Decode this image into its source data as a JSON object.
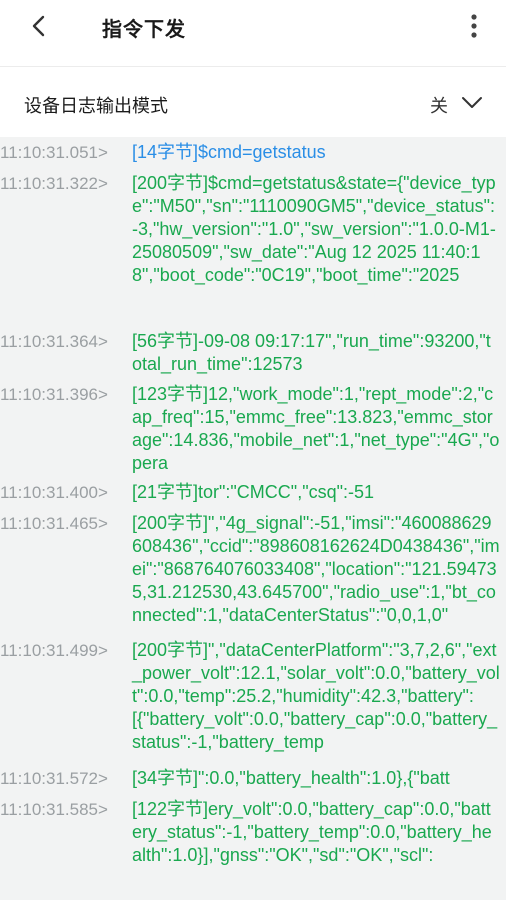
{
  "header": {
    "title": "指令下发",
    "back_icon": "chevron-left-icon",
    "more_icon": "more-vertical-icon"
  },
  "setting": {
    "label": "设备日志输出模式",
    "value": "关",
    "icon": "chevron-down-icon"
  },
  "log": {
    "colors": {
      "timestamp": "#9a9fa2",
      "sent": "#2a8ee6",
      "received": "#19a84f"
    },
    "entries": [
      {
        "time": "11:10:31.051>",
        "text": "[14字节]$cmd=getstatus",
        "kind": "sent"
      },
      {
        "time": "11:10:31.322>",
        "text": "[200字节]$cmd=getstatus&state={\"device_type\":\"M50\",\"sn\":\"1110090GM5\",\"device_status\":-3,\"hw_version\":\"1.0\",\"sw_version\":\"1.0.0-M1-25080509\",\"sw_date\":\"Aug 12 2025 11:40:18\",\"boot_code\":\"0C19\",\"boot_time\":\"2025",
        "kind": "received"
      },
      {
        "time": "11:10:31.364>",
        "text": "[56字节]-09-08 09:17:17\",\"run_time\":93200,\"total_run_time\":12573",
        "kind": "received"
      },
      {
        "time": "11:10:31.396>",
        "text": "[123字节]12,\"work_mode\":1,\"rept_mode\":2,\"cap_freq\":15,\"emmc_free\":13.823,\"emmc_storage\":14.836,\"mobile_net\":1,\"net_type\":\"4G\",\"opera",
        "kind": "received"
      },
      {
        "time": "11:10:31.400>",
        "text": "[21字节]tor\":\"CMCC\",\"csq\":-51",
        "kind": "received"
      },
      {
        "time": "11:10:31.465>",
        "text": "[200字节]\",\"4g_signal\":-51,\"imsi\":\"460088629608436\",\"ccid\":\"898608162624D0438436\",\"imei\":\"868764076033408\",\"location\":\"121.594735,31.212530,43.645700\",\"radio_use\":1,\"bt_connected\":1,\"dataCenterStatus\":\"0,0,1,0\"",
        "kind": "received"
      },
      {
        "time": "11:10:31.499>",
        "text": "[200字节]\",\"dataCenterPlatform\":\"3,7,2,6\",\"ext_power_volt\":12.1,\"solar_volt\":0.0,\"battery_volt\":0.0,\"temp\":25.2,\"humidity\":42.3,\"battery\":[{\"battery_volt\":0.0,\"battery_cap\":0.0,\"battery_status\":-1,\"battery_temp",
        "kind": "received"
      },
      {
        "time": "11:10:31.572>",
        "text": "[34字节]\":0.0,\"battery_health\":1.0},{\"batt",
        "kind": "received"
      },
      {
        "time": "11:10:31.585>",
        "text": "[122字节]ery_volt\":0.0,\"battery_cap\":0.0,\"battery_status\":-1,\"battery_temp\":0.0,\"battery_health\":1.0}],\"gnss\":\"OK\",\"sd\":\"OK\",\"scl\":",
        "kind": "received"
      }
    ]
  }
}
